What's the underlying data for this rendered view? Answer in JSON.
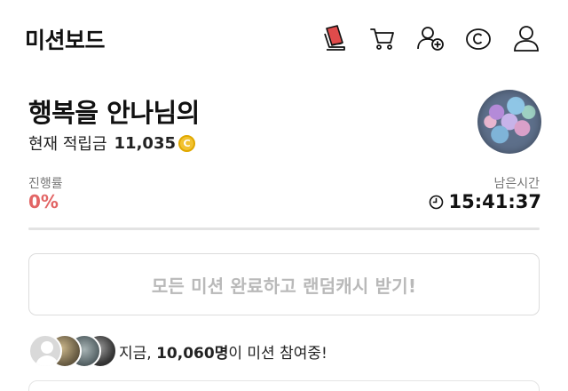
{
  "header": {
    "title": "미션보드",
    "icons": [
      {
        "name": "ticket-icon",
        "color": "#e04b4b"
      },
      {
        "name": "cart-icon"
      },
      {
        "name": "add-friend-icon"
      },
      {
        "name": "coin-icon"
      },
      {
        "name": "profile-icon"
      }
    ]
  },
  "profile": {
    "greeting": "행복을 안나님의",
    "balance_label": "현재 적립금",
    "balance_value": "11,035",
    "coin_symbol": "C"
  },
  "progress": {
    "label": "진행률",
    "value": "0%",
    "color": "#e26565"
  },
  "time": {
    "label": "남은시간",
    "value": "15:41:37"
  },
  "action": {
    "label": "모든 미션 완료하고 랜덤캐시 받기!"
  },
  "participants": {
    "prefix": "지금, ",
    "count": "10,060명",
    "suffix": "이 미션 참여중!"
  }
}
